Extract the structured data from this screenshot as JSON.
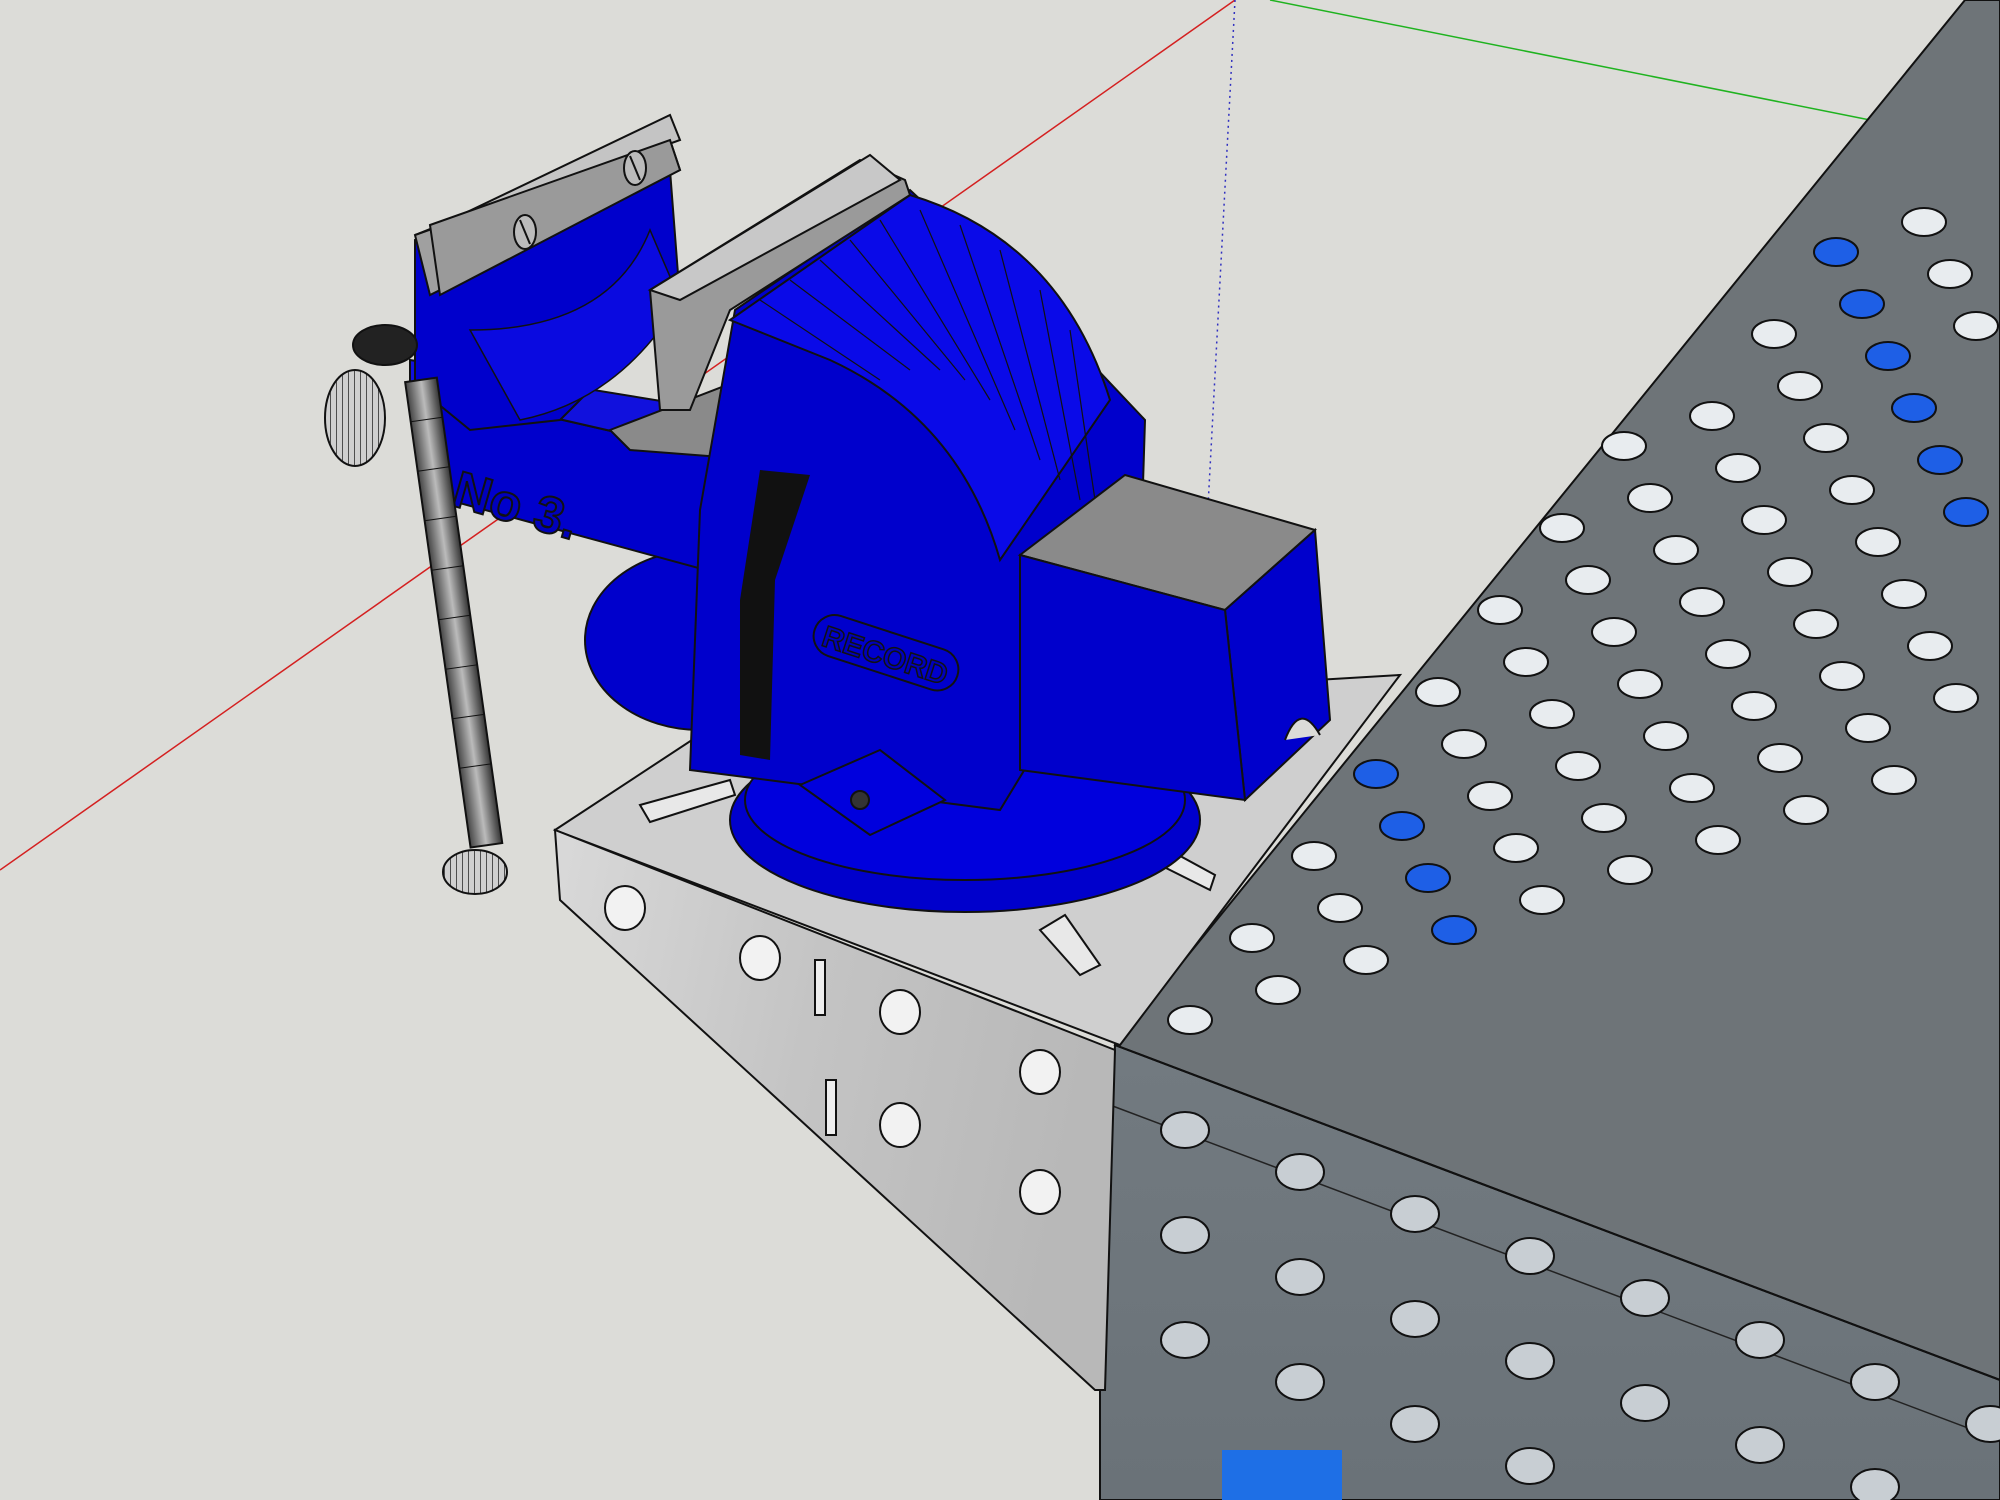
{
  "app": {
    "view_style": "Hidden Line / shaded with edges",
    "background_color": "#dcdcd8"
  },
  "model": {
    "vise": {
      "body_marking": "No 3.",
      "brand_plate": "RECORD",
      "body_color": "#0000cc",
      "jaw_color": "#8a8a8a"
    },
    "table": {
      "top_color": "#6e7478",
      "block_color": "#c9c9c9",
      "hole_highlight_color": "#1e5fe6"
    },
    "axes": {
      "red_axis": "#d42020",
      "green_axis": "#1fb31f",
      "blue_axis": "#3030c0"
    }
  }
}
